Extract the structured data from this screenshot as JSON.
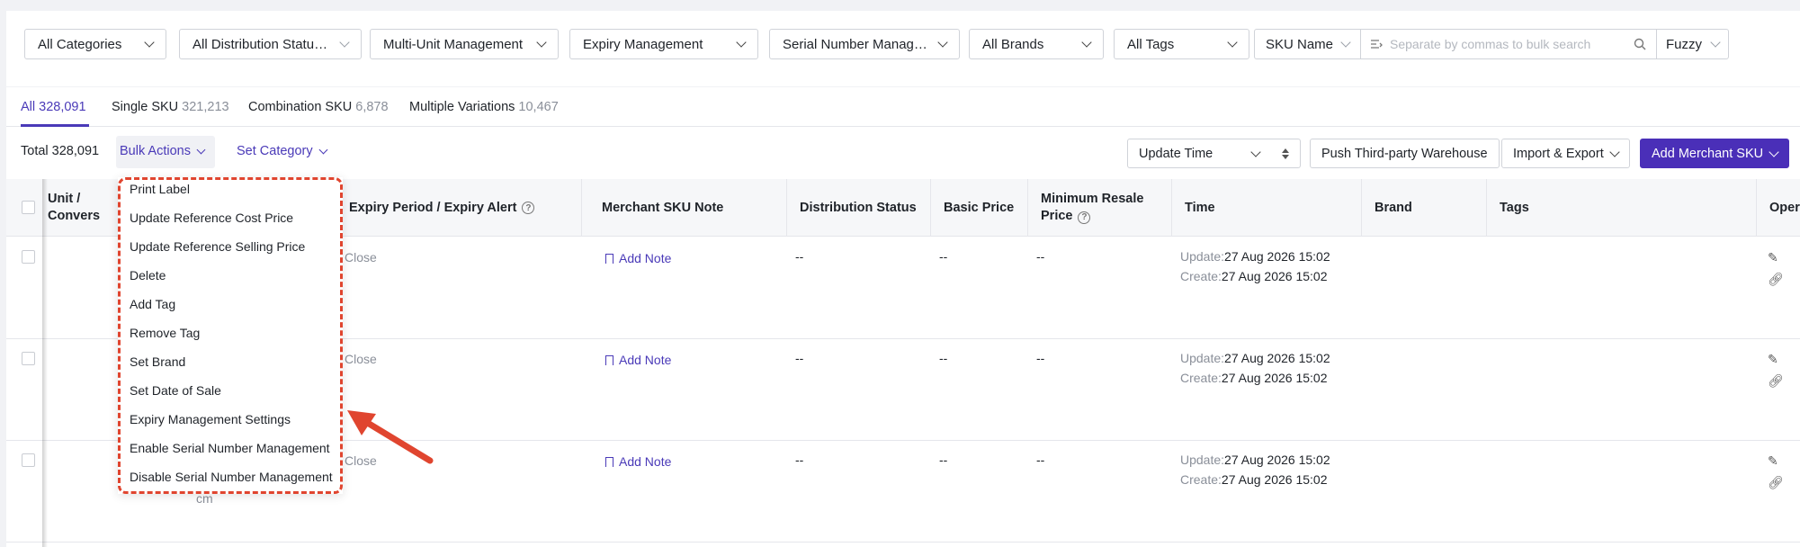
{
  "filters": {
    "categories": "All Categories",
    "distribution": "All Distribution Statuses",
    "multi_unit": "Multi-Unit Management",
    "expiry": "Expiry Management",
    "serial": "Serial Number Managem...",
    "brands": "All Brands",
    "tags": "All Tags",
    "sku_field": "SKU Name",
    "search_placeholder": "Separate by commas to bulk search",
    "match_mode": "Fuzzy"
  },
  "tabs": [
    {
      "label": "All",
      "count": "328,091"
    },
    {
      "label": "Single SKU",
      "count": "321,213"
    },
    {
      "label": "Combination SKU",
      "count": "6,878"
    },
    {
      "label": "Multiple Variations",
      "count": "10,467"
    }
  ],
  "toolbar": {
    "total": "Total 328,091",
    "bulk_actions": "Bulk Actions",
    "set_category": "Set Category",
    "sort_field": "Update Time",
    "push_warehouse": "Push Third-party Warehouse",
    "import_export": "Import & Export",
    "add_sku": "Add Merchant SKU"
  },
  "columns": {
    "unit": "Unit / Convers",
    "expiry": "Expiry Period / Expiry Alert",
    "note": "Merchant SKU Note",
    "distribution": "Distribution Status",
    "basic_price": "Basic Price",
    "min_resale_1": "Minimum Resale",
    "min_resale_2": "Price",
    "time": "Time",
    "brand": "Brand",
    "tags": "Tags",
    "operation": "Opera"
  },
  "rows": [
    {
      "expiry": "Close",
      "note": "Add Note",
      "distribution": "--",
      "basic_price": "--",
      "min_resale": "--",
      "update_label": "Update:",
      "update": "27 Aug 2026 15:02",
      "create_label": "Create:",
      "create": "27 Aug 2026 15:02"
    },
    {
      "expiry": "Close",
      "note": "Add Note",
      "distribution": "--",
      "basic_price": "--",
      "min_resale": "--",
      "update_label": "Update:",
      "update": "27 Aug 2026 15:02",
      "create_label": "Create:",
      "create": "27 Aug 2026 15:02"
    },
    {
      "expiry": "Close",
      "note": "Add Note",
      "distribution": "--",
      "basic_price": "--",
      "min_resale": "--",
      "update_label": "Update:",
      "update": "27 Aug 2026 15:02",
      "create_label": "Create:",
      "create": "27 Aug 2026 15:02",
      "unit_suffix": "cm"
    }
  ],
  "bulk_menu": [
    "Print Label",
    "Update Reference Cost Price",
    "Update Reference Selling Price",
    "Delete",
    "Add Tag",
    "Remove Tag",
    "Set Brand",
    "Set Date of Sale",
    "Expiry Management Settings",
    "Enable Serial Number Management",
    "Disable Serial Number Management"
  ],
  "colors": {
    "accent": "#4a2fb8",
    "annotation": "#e0452f"
  }
}
